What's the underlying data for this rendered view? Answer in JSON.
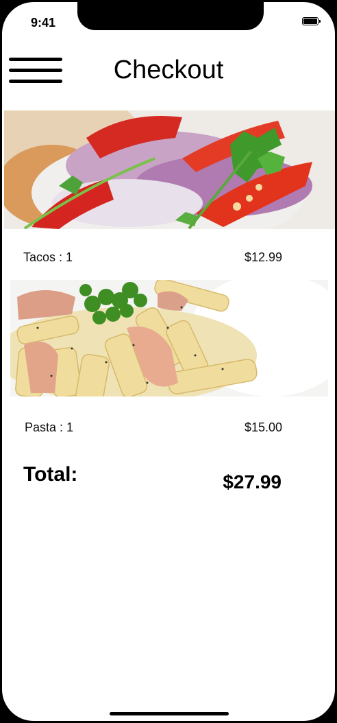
{
  "status_bar": {
    "time": "9:41"
  },
  "header": {
    "title": "Checkout"
  },
  "items": [
    {
      "name": "Tacos : 1",
      "price": "$12.99"
    },
    {
      "name": "Pasta : 1",
      "price": "$15.00"
    }
  ],
  "summary": {
    "total_label": "Total:",
    "total_value": "$27.99"
  }
}
